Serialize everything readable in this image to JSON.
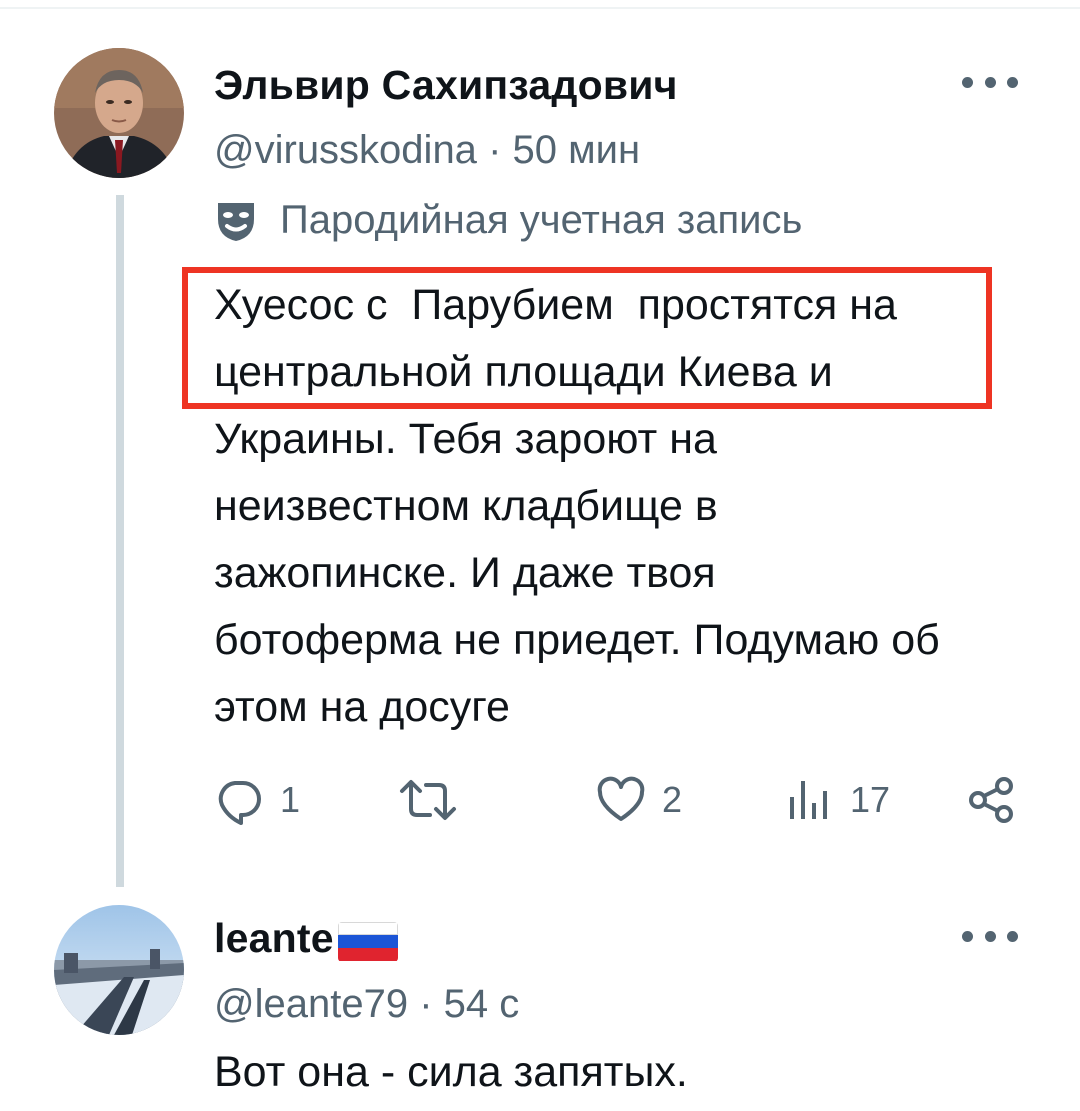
{
  "tweet": {
    "author_name": "Эльвир Сахипзадович",
    "handle": "@virusskodina",
    "separator": "·",
    "time": "50 мин",
    "parody_label": "Пародийная учетная запись",
    "text_lines": [
      "Хуесос с  Парубием  простятся на",
      "центральной площади Киева и",
      "Украины. Тебя зароют на",
      "неизвестном кладбище в",
      "зажопинске. И даже твоя",
      "ботоферма не приедет. Подумаю об",
      "этом на досуге"
    ],
    "highlight_color": "#ee3423",
    "actions": {
      "reply_count": "1",
      "retweet_count": "",
      "like_count": "2",
      "views_count": "17"
    },
    "icons": [
      "more-icon",
      "parody-mask-icon",
      "reply-icon",
      "retweet-icon",
      "like-icon",
      "views-icon",
      "share-icon"
    ]
  },
  "reply": {
    "author_name": "leante",
    "flag": "russia-flag",
    "handle": "@leante79",
    "separator": "·",
    "time": "54 с",
    "text": "Вот она - сила запятых."
  },
  "colors": {
    "text": "#0f1419",
    "secondary": "#536471",
    "thread_line": "#cfd9de"
  }
}
